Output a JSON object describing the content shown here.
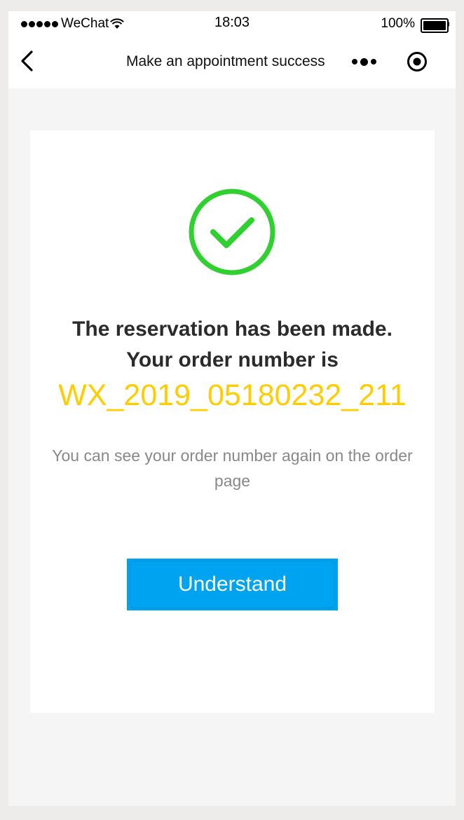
{
  "status_bar": {
    "carrier": "WeChat",
    "time": "18:03",
    "battery": "100%"
  },
  "nav": {
    "title": "Make an appointment success"
  },
  "card": {
    "headline_line1": "The reservation has been made.",
    "headline_line2": "Your order number is",
    "order_number": "WX_2019_05180232_211",
    "hint": "You can see your order number again on the order page",
    "button_label": "Understand"
  },
  "colors": {
    "success_green": "#2fd02f",
    "order_number_yellow": "#ffcc00",
    "button_blue": "#00a3ef"
  }
}
